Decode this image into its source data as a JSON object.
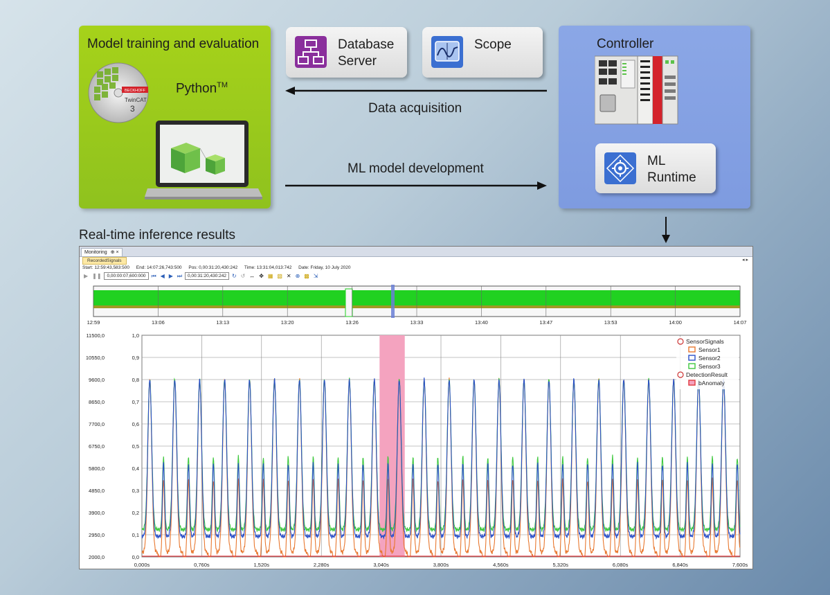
{
  "python_panel": {
    "title": "Model training and evaluation",
    "python_label": "Python",
    "tm": "TM",
    "cd_brand": "BECKHOFF",
    "cd_label": "TwinCAT",
    "cd_version": "3"
  },
  "tools": {
    "database": {
      "line1": "Database",
      "line2": "Server"
    },
    "scope": {
      "label": "Scope"
    }
  },
  "arrows": {
    "data_acquisition": "Data acquisition",
    "ml_development": "ML model development"
  },
  "controller_panel": {
    "title": "Controller",
    "ml_runtime": {
      "line1": "ML",
      "line2": "Runtime"
    }
  },
  "realtime_label": "Real-time inference results",
  "scope_window": {
    "tab": "Monitoring",
    "tab_pin": "⊕ ×",
    "subtab": "RecordedSignals",
    "nav": "◂ ▸",
    "info": {
      "start": "Start:  12:59:43,583:500",
      "end": "End:   14:07:26,743:500",
      "pos": "Pos:  0,00:31:20,430:242",
      "time": "Time:  13:31:04,013:742",
      "date": "Date:   Friday, 10 July 2020"
    },
    "toolbar": {
      "field1": "0,00:00:07,600:000",
      "field2": "0,00:31:20,430:242"
    },
    "overview_ticks": [
      "12:59",
      "13:06",
      "13:13",
      "13:20",
      "13:26",
      "13:33",
      "13:40",
      "13:47",
      "13:53",
      "14:00",
      "14:07"
    ],
    "legend": {
      "group1": "SensorSignals",
      "items1": [
        "Sensor1",
        "Sensor2",
        "Sensor3"
      ],
      "group2": "DetectionResult",
      "items2": [
        "bAnomaly"
      ]
    }
  },
  "chart_data": {
    "type": "line",
    "x_ticks": [
      "0,000s",
      "0,760s",
      "1,520s",
      "2,280s",
      "3,040s",
      "3,800s",
      "4,560s",
      "5,320s",
      "6,080s",
      "6,840s",
      "7,600s"
    ],
    "y_left_ticks": [
      "11500,0",
      "10550,0",
      "9600,0",
      "8650,0",
      "7700,0",
      "6750,0",
      "5800,0",
      "4850,0",
      "3900,0",
      "2950,0",
      "2000,0"
    ],
    "y_right_ticks": [
      "1,0",
      "0,9",
      "0,8",
      "0,7",
      "0,6",
      "0,5",
      "0,4",
      "0,3",
      "0,2",
      "0,1",
      "0,0"
    ],
    "ylim_left": [
      2000,
      11500
    ],
    "ylim_right": [
      0,
      1
    ],
    "xlim": [
      0,
      7.6
    ],
    "series": [
      {
        "name": "Sensor1",
        "color": "#e8772e"
      },
      {
        "name": "Sensor2",
        "color": "#2a4fc8"
      },
      {
        "name": "Sensor3",
        "color": "#3ec83e"
      },
      {
        "name": "bAnomaly",
        "color": "#e0393e",
        "anomaly_range_s": [
          3.02,
          3.34
        ]
      }
    ],
    "period_s": 0.317,
    "peak_value": 9600,
    "trough_value": 2950,
    "cycles": 24
  },
  "colors": {
    "green_panel": "#9ccb1c",
    "blue_panel": "#839fe3",
    "anomaly_fill": "#f4a3bf"
  }
}
